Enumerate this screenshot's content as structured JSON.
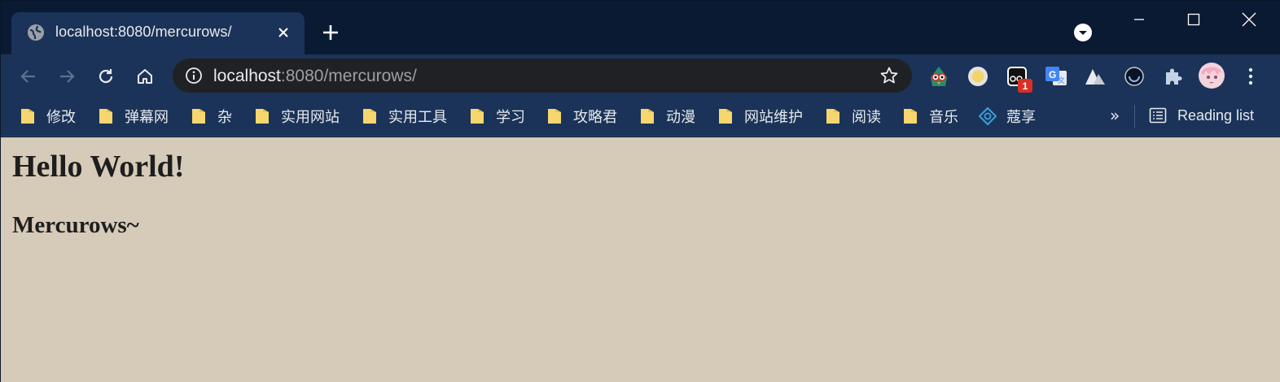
{
  "tab": {
    "title": "localhost:8080/mercurows/",
    "icon": "globe-icon"
  },
  "toolbar": {
    "url_host": "localhost",
    "url_rest": ":8080/mercurows/",
    "extension_badge": "1"
  },
  "bookmarks": [
    {
      "label": "修改",
      "icon": "folder-icon"
    },
    {
      "label": "弹幕网",
      "icon": "folder-icon"
    },
    {
      "label": "杂",
      "icon": "folder-icon"
    },
    {
      "label": "实用网站",
      "icon": "folder-icon"
    },
    {
      "label": "实用工具",
      "icon": "folder-icon"
    },
    {
      "label": "学习",
      "icon": "folder-icon"
    },
    {
      "label": "攻略君",
      "icon": "folder-icon"
    },
    {
      "label": "动漫",
      "icon": "folder-icon"
    },
    {
      "label": "网站维护",
      "icon": "folder-icon"
    },
    {
      "label": "阅读",
      "icon": "folder-icon"
    },
    {
      "label": "音乐",
      "icon": "folder-icon"
    },
    {
      "label": "蔻享",
      "icon": "site-icon"
    }
  ],
  "bookmarks_overflow": "»",
  "reading_list": "Reading list",
  "page": {
    "heading1": "Hello World!",
    "heading2": "Mercurows~"
  },
  "colors": {
    "frame": "#0b1a33",
    "toolbar": "#1b3358",
    "omnibox": "#202124",
    "page_background": "#d6cbb8",
    "folder": "#f6d66e",
    "badge": "#d93025"
  }
}
